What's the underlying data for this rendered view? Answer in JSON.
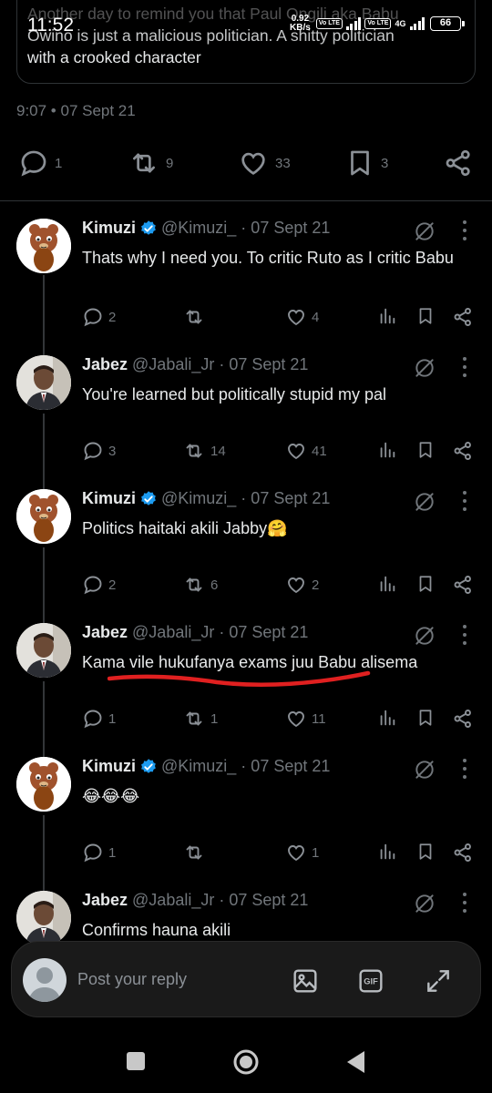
{
  "status": {
    "time": "11:52",
    "speed_value": "0.92",
    "speed_unit": "KB/s",
    "volte1": "Vo LTE",
    "volte2": "Vo LTE",
    "net_type": "4G",
    "battery": "66"
  },
  "quoted": {
    "line1": "Another day to remind you that Paul Ongili aka Babu",
    "line2": "Owino is just a malicious politician. A shitty politician",
    "line3": "with a crooked character"
  },
  "meta": "9:07 • 07 Sept 21",
  "main_actions": {
    "replies": "1",
    "retweets": "9",
    "likes": "33",
    "bookmarks": "3"
  },
  "replies": [
    {
      "name": "Kimuzi",
      "handle": "@Kimuzi_ · 07 Sept 21",
      "verified": true,
      "avatar": "cartoon-bear",
      "text": "Thats why I need you. To critic Ruto as I critic Babu",
      "replies": "2",
      "retweets": "",
      "likes": "4"
    },
    {
      "name": "Jabez",
      "handle": "@Jabali_Jr · 07 Sept 21",
      "verified": false,
      "avatar": "man-photo",
      "text": "You're learned but politically stupid my pal",
      "replies": "3",
      "retweets": "14",
      "likes": "41"
    },
    {
      "name": "Kimuzi",
      "handle": "@Kimuzi_ · 07 Sept 21",
      "verified": true,
      "avatar": "cartoon-bear",
      "text": "Politics haitaki akili Jabby🤗",
      "replies": "2",
      "retweets": "6",
      "likes": "2"
    },
    {
      "name": "Jabez",
      "handle": "@Jabali_Jr · 07 Sept 21",
      "verified": false,
      "avatar": "man-photo",
      "text": "Kama vile hukufanya exams juu Babu alisema",
      "replies": "1",
      "retweets": "1",
      "likes": "11"
    },
    {
      "name": "Kimuzi",
      "handle": "@Kimuzi_ · 07 Sept 21",
      "verified": true,
      "avatar": "cartoon-bear",
      "text": "😂😂😂",
      "replies": "1",
      "retweets": "",
      "likes": "1"
    },
    {
      "name": "Jabez",
      "handle": "@Jabali_Jr · 07 Sept 21",
      "verified": false,
      "avatar": "man-photo",
      "text": "Confirms hauna akili",
      "replies": "",
      "retweets": "",
      "likes": ""
    }
  ],
  "reply_bar": {
    "placeholder": "Post your reply"
  },
  "colors": {
    "background": "#000000",
    "text": "#e7e9ea",
    "muted": "#71767b",
    "verified": "#1d9bf0",
    "underline": "#e02020"
  }
}
